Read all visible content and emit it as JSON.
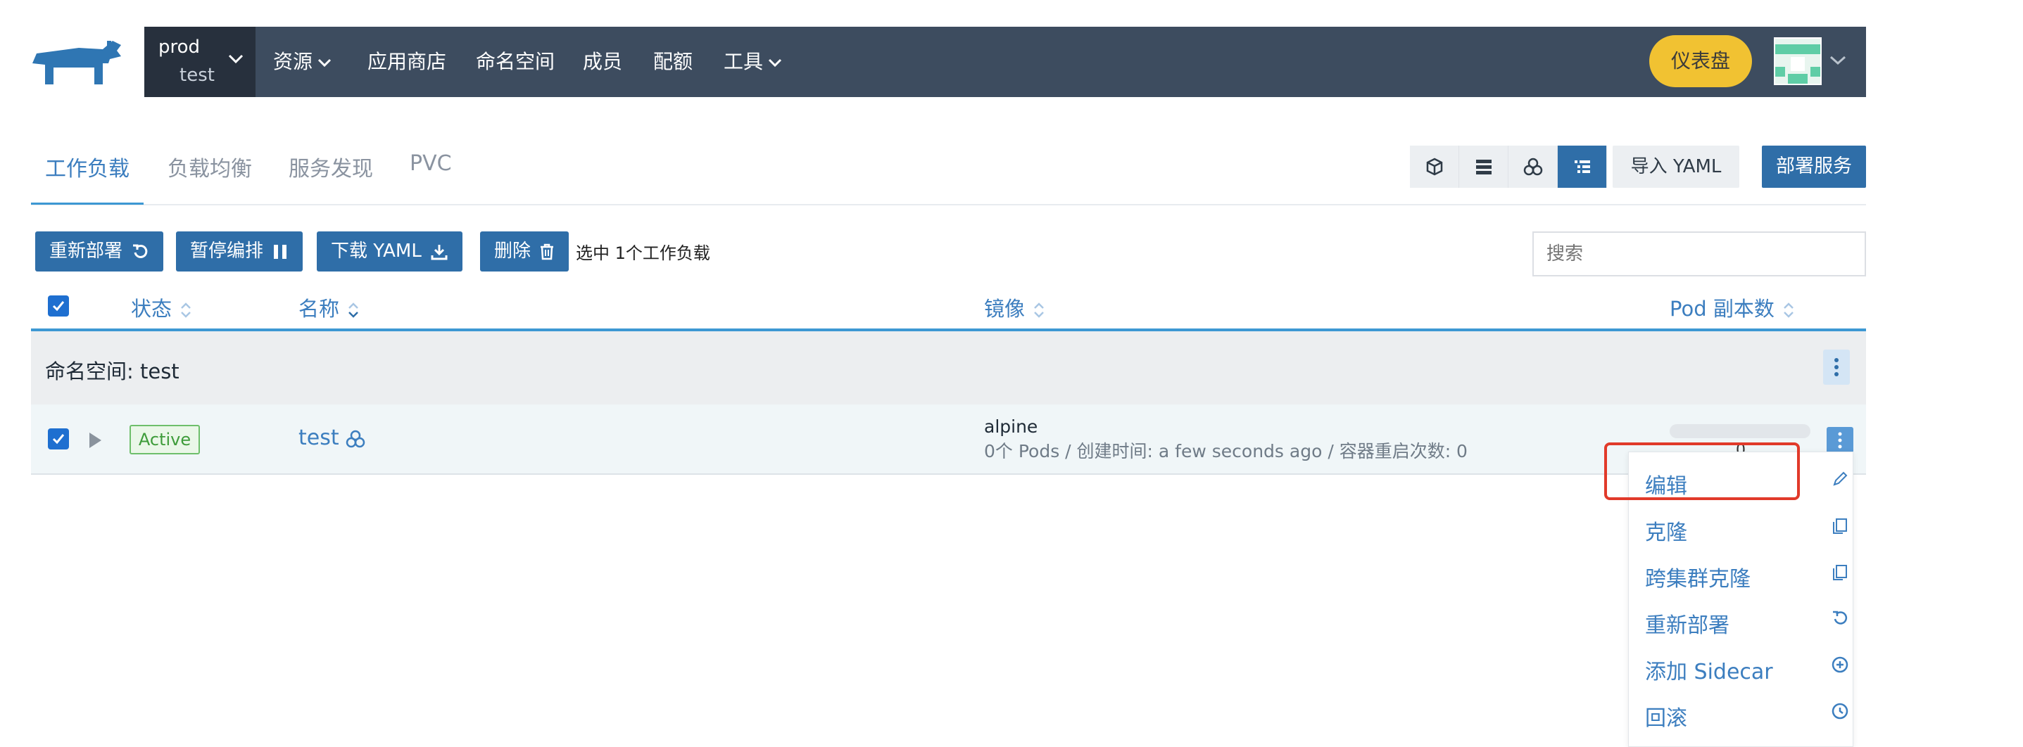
{
  "header": {
    "cluster": "prod",
    "project": "test",
    "nav": [
      "资源",
      "应用商店",
      "命名空间",
      "成员",
      "配额",
      "工具"
    ],
    "dashboard_label": "仪表盘"
  },
  "tabs": [
    "工作负载",
    "负载均衡",
    "服务发现",
    "PVC"
  ],
  "actions": {
    "import_yaml": "导入 YAML",
    "deploy": "部署服务"
  },
  "bulk": {
    "redeploy": "重新部署",
    "pause": "暂停编排",
    "download_yaml": "下载 YAML",
    "delete": "删除",
    "selected_text": "选中 1个工作负载"
  },
  "search": {
    "placeholder": "搜索"
  },
  "table": {
    "columns": [
      "状态",
      "名称",
      "镜像",
      "Pod 副本数"
    ],
    "group_label": "命名空间: test",
    "rows": [
      {
        "status": "Active",
        "name": "test",
        "image": "alpine",
        "meta": "0个 Pods / 创建时间: a few seconds ago / 容器重启次数: 0",
        "pod_count": "0"
      }
    ]
  },
  "menu": {
    "items": [
      "编辑",
      "克隆",
      "跨集群克隆",
      "重新部署",
      "添加 Sidecar",
      "回滚"
    ],
    "highlighted": "编辑"
  },
  "colors": {
    "navbar": "#3d4c5f",
    "primary": "#2f6ea8",
    "link": "#3c7ebf",
    "dashboard": "#f1c232",
    "highlight": "#e13a2a",
    "active_badge": "#3e9c3a"
  }
}
